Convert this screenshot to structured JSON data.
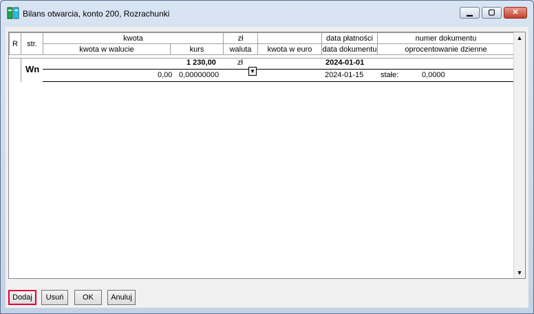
{
  "window": {
    "title": "Bilans otwarcia, konto 200, Rozrachunki",
    "buttons": {
      "minimize": "▁",
      "maximize": "▢",
      "close": "✕"
    }
  },
  "grid": {
    "header_row1": [
      "R",
      "str.",
      "kwota",
      "zł",
      "",
      "data płatności",
      "numer dokumentu"
    ],
    "header_row2": [
      "kwota w walucie",
      "kurs",
      "waluta",
      "kwota w euro",
      "data dokumentu",
      "oprocentowanie dzienne"
    ],
    "entry": {
      "side": "Wn",
      "amount": "1 230,00",
      "currency": "zł",
      "payment_date": "2024-01-01",
      "amount_in_currency": "0,00",
      "rate": "0,00000000",
      "document_date": "2024-01-15",
      "interest_type": "stałe:",
      "interest_value": "0,0000"
    }
  },
  "buttons": {
    "add": "Dodaj",
    "remove": "Usuń",
    "ok": "OK",
    "cancel": "Anuluj"
  }
}
